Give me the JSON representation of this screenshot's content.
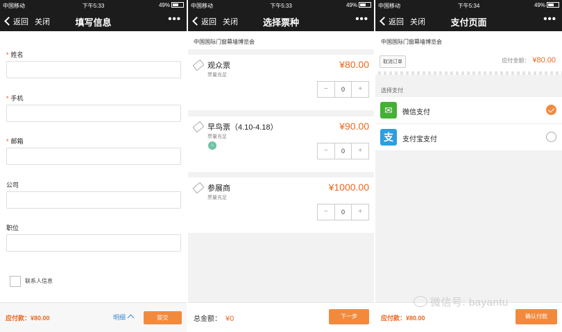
{
  "status": {
    "carrier": "中国移动",
    "battery": "49%",
    "times": [
      "下午5:33",
      "下午5:33",
      "下午5:34"
    ]
  },
  "nav": {
    "back": "返回",
    "close": "关闭",
    "more": "•••",
    "titles": [
      "填写信息",
      "选择票种",
      "支付页面"
    ]
  },
  "form": {
    "fields": [
      {
        "label": "姓名",
        "required": "*"
      },
      {
        "label": "手机",
        "required": "*"
      },
      {
        "label": "邮箱",
        "required": "*"
      },
      {
        "label": "公司",
        "required": ""
      },
      {
        "label": "职位",
        "required": ""
      }
    ],
    "contact_label": "联系人信息",
    "due_label": "应付款：¥80.00",
    "detail_label": "明细",
    "submit_label": "提交"
  },
  "tickets": {
    "expo_name": "中国国际门窗幕墙博览会",
    "items": [
      {
        "name": "观众票",
        "status": "票量充足",
        "price": "¥80.00",
        "qty": "0"
      },
      {
        "name": "早鸟票（4.10-4.18）",
        "status": "票量充足",
        "price": "¥90.00",
        "qty": "0",
        "badge": "⌂"
      },
      {
        "name": "参展商",
        "status": "票量充足",
        "price": "¥1000.00",
        "qty": "0"
      }
    ],
    "minus": "−",
    "plus": "+",
    "total_label": "总金额：",
    "total_value": "¥0",
    "next_label": "下一步"
  },
  "payment": {
    "expo_name": "中国国际门窗幕墙博览会",
    "cancel_label": "取消订单",
    "payable_label": "应付金额：",
    "payable_value": "¥80.00",
    "choose_label": "选择支付",
    "methods": [
      {
        "label": "微信支付",
        "icon": "wechat-icon",
        "selected": true
      },
      {
        "label": "支付宝支付",
        "icon": "alipay-icon",
        "selected": false
      }
    ],
    "due_label": "应付款：¥80.00",
    "confirm_label": "确认付款"
  },
  "watermark": "微信号: bayantu",
  "colors": {
    "accent": "#f28a3e",
    "price": "#e8681f",
    "link": "#3a8bd6",
    "wechat": "#44b035",
    "alipay": "#2d9ee0"
  }
}
